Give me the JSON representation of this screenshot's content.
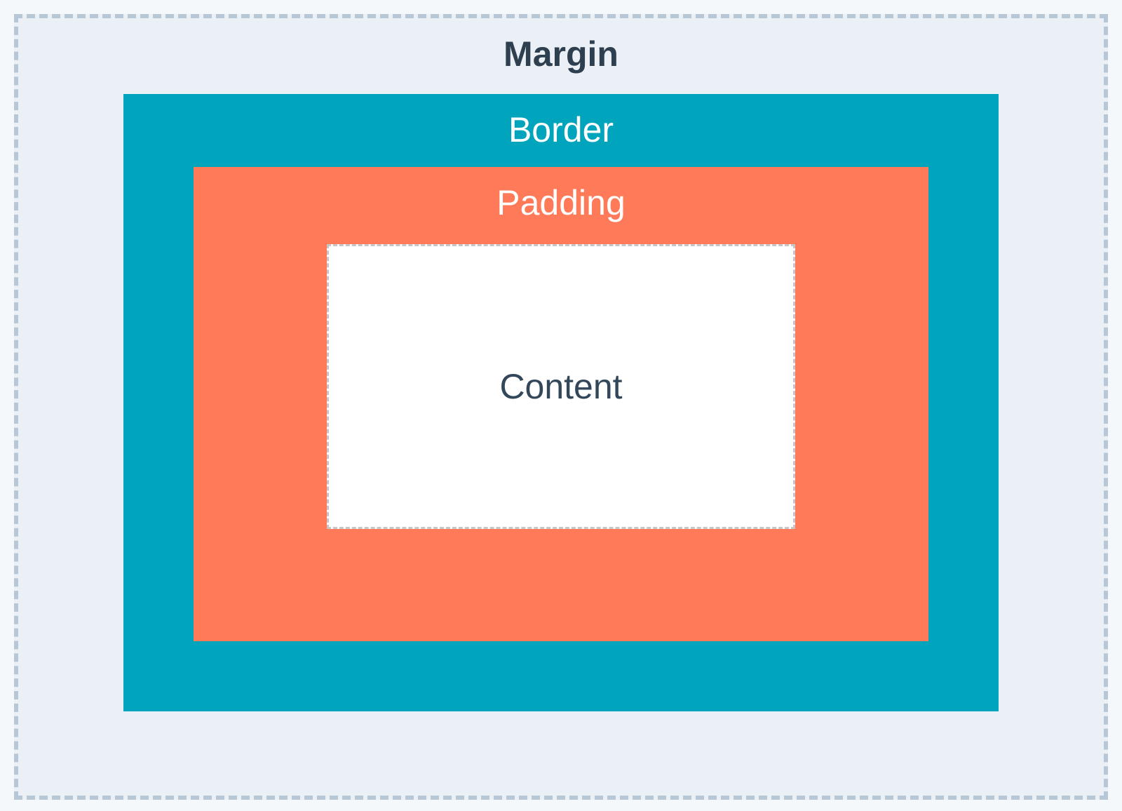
{
  "boxModel": {
    "margin": {
      "label": "Margin",
      "backgroundColor": "#eaf0f6",
      "borderStyle": "dashed",
      "borderColor": "#b8c7d6",
      "textColor": "#2e3f50"
    },
    "border": {
      "label": "Border",
      "backgroundColor": "#00a4bd",
      "textColor": "#ffffff"
    },
    "padding": {
      "label": "Padding",
      "backgroundColor": "#ff7a59",
      "textColor": "#ffffff"
    },
    "content": {
      "label": "Content",
      "backgroundColor": "#ffffff",
      "borderStyle": "dashed",
      "borderColor": "#c7c7c7",
      "textColor": "#33475b"
    }
  }
}
